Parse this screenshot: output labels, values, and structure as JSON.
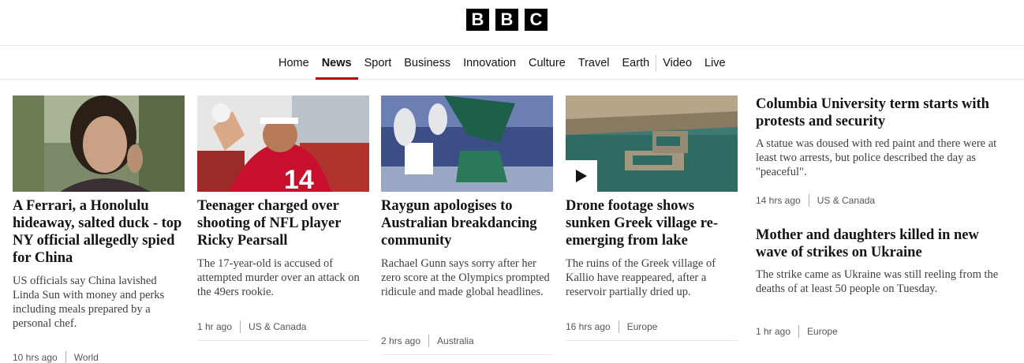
{
  "logo": {
    "letters": [
      "B",
      "B",
      "C"
    ]
  },
  "nav": {
    "items": [
      {
        "label": "Home",
        "active": false
      },
      {
        "label": "News",
        "active": true
      },
      {
        "label": "Sport",
        "active": false
      },
      {
        "label": "Business",
        "active": false
      },
      {
        "label": "Innovation",
        "active": false
      },
      {
        "label": "Culture",
        "active": false
      },
      {
        "label": "Travel",
        "active": false
      },
      {
        "label": "Earth",
        "active": false
      },
      {
        "label": "Video",
        "active": false
      },
      {
        "label": "Live",
        "active": false
      }
    ]
  },
  "stories": [
    {
      "headline": "A Ferrari, a Honolulu hideaway, salted duck - top NY official allegedly spied for China",
      "summary": "US officials say China lavished Linda Sun with money and perks including meals prepared by a personal chef.",
      "time": "10 hrs ago",
      "region": "World"
    },
    {
      "headline": "Teenager charged over shooting of NFL player Ricky Pearsall",
      "summary": "The 17-year-old is accused of attempted murder over an attack on the 49ers rookie.",
      "time": "1 hr ago",
      "region": "US & Canada"
    },
    {
      "headline": "Raygun apologises to Australian breakdancing community",
      "summary": "Rachael Gunn says sorry after her zero score at the Olympics prompted ridicule and made global headlines.",
      "time": "2 hrs ago",
      "region": "Australia"
    },
    {
      "headline": "Drone footage shows sunken Greek village re-emerging from lake",
      "summary": "The ruins of the Greek village of Kallio have reappeared, after a reservoir partially dried up.",
      "time": "16 hrs ago",
      "region": "Europe"
    }
  ],
  "side_stories": [
    {
      "headline": "Columbia University term starts with protests and security",
      "summary": "A statue was doused with red paint and there were at least two arrests, but police described the day as \"peaceful\".",
      "time": "14 hrs ago",
      "region": "US & Canada"
    },
    {
      "headline": "Mother and daughters killed in new wave of strikes on Ukraine",
      "summary": "The strike came as Ukraine was still reeling from the deaths of at least 50 people on Tuesday.",
      "time": "1 hr ago",
      "region": "Europe"
    }
  ],
  "colors": {
    "accent": "#b80000",
    "text": "#141414",
    "meta": "#545658"
  }
}
